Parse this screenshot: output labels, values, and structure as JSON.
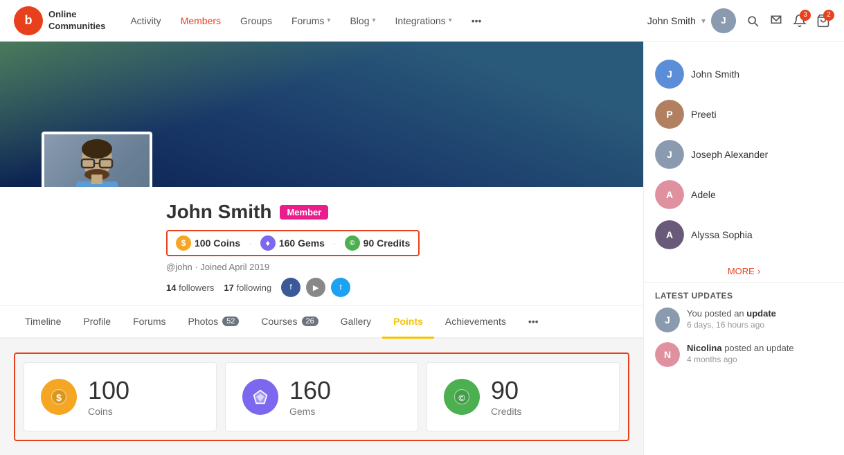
{
  "brand": {
    "logo_letter": "b",
    "name_line1": "Online",
    "name_line2": "Communities"
  },
  "nav": {
    "items": [
      {
        "label": "Activity",
        "active": false
      },
      {
        "label": "Members",
        "active": true
      },
      {
        "label": "Groups",
        "active": false
      },
      {
        "label": "Forums",
        "active": false,
        "has_dropdown": true
      },
      {
        "label": "Blog",
        "active": false,
        "has_dropdown": true
      },
      {
        "label": "Integrations",
        "active": false,
        "has_dropdown": true
      },
      {
        "label": "•••",
        "active": false
      }
    ],
    "user": {
      "name": "John Smith",
      "chevron": "▾"
    }
  },
  "profile": {
    "name": "John Smith",
    "badge": "Member",
    "points": {
      "coins": {
        "value": "100",
        "label": "Coins",
        "symbol": "$"
      },
      "gems": {
        "value": "160",
        "label": "Gems",
        "symbol": "♦"
      },
      "credits": {
        "value": "90",
        "label": "Credits",
        "symbol": "©"
      }
    },
    "points_text": "100 Coins  160 Gems  90 Credits",
    "handle": "@john",
    "joined": "Joined April 2019",
    "followers": "14",
    "following": "17",
    "tabs": [
      {
        "label": "Timeline",
        "active": false
      },
      {
        "label": "Profile",
        "active": false
      },
      {
        "label": "Forums",
        "active": false
      },
      {
        "label": "Photos",
        "active": false,
        "badge": "52"
      },
      {
        "label": "Courses",
        "active": false,
        "badge": "26"
      },
      {
        "label": "Gallery",
        "active": false
      },
      {
        "label": "Points",
        "active": true
      },
      {
        "label": "Achievements",
        "active": false
      },
      {
        "label": "•••",
        "active": false
      }
    ]
  },
  "cards": [
    {
      "type": "coin",
      "value": "100",
      "label": "Coins",
      "symbol": "$"
    },
    {
      "type": "gem",
      "value": "160",
      "label": "Gems",
      "symbol": "♦"
    },
    {
      "type": "credit",
      "value": "90",
      "label": "Credits",
      "symbol": "©"
    }
  ],
  "sidebar": {
    "members": [
      {
        "name": "John Smith",
        "color": "av-blue",
        "initial": "J"
      },
      {
        "name": "Preeti",
        "color": "av-brown",
        "initial": "P"
      },
      {
        "name": "Joseph Alexander",
        "color": "av-gray",
        "initial": "J"
      },
      {
        "name": "Adele",
        "color": "av-pink",
        "initial": "A"
      },
      {
        "name": "Alyssa Sophia",
        "color": "av-dark",
        "initial": "A"
      }
    ],
    "more_label": "MORE",
    "latest_title": "LATEST UPDATES",
    "updates": [
      {
        "text_start": "You posted an",
        "text_bold": "update",
        "time": "6 days, 16 hours ago",
        "color": "av-gray",
        "initial": "J"
      },
      {
        "text_start": "",
        "text_bold": "Nicolina",
        "text_end": " posted an update",
        "time": "4 months ago",
        "color": "av-pink",
        "initial": "N"
      }
    ]
  }
}
